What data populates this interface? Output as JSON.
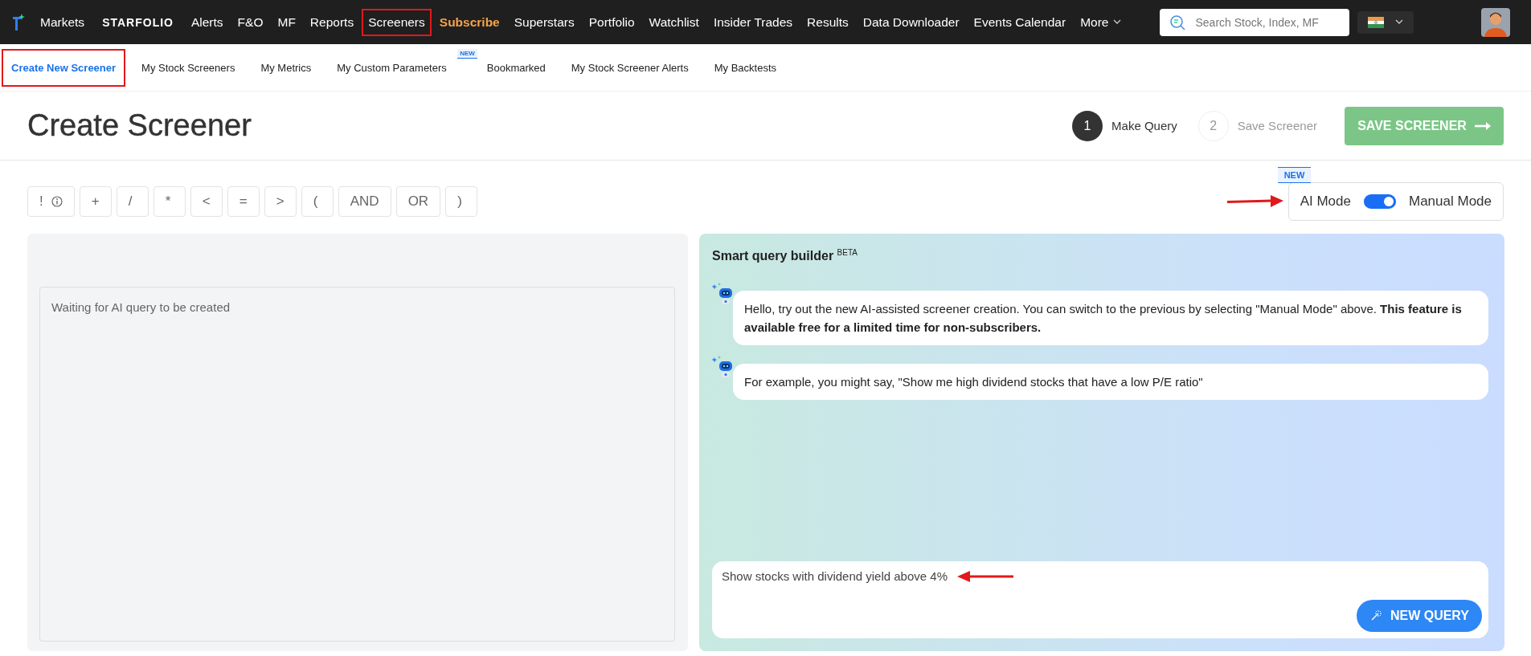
{
  "top_nav": {
    "items": [
      {
        "label": "Markets",
        "kind": "link",
        "highlighted": false
      },
      {
        "label": "STARFOLIO",
        "kind": "logo",
        "highlighted": false
      },
      {
        "label": "Alerts",
        "kind": "link",
        "highlighted": false
      },
      {
        "label": "F&O",
        "kind": "link",
        "highlighted": false
      },
      {
        "label": "MF",
        "kind": "link",
        "highlighted": false
      },
      {
        "label": "Reports",
        "kind": "link",
        "highlighted": false
      },
      {
        "label": "Screeners",
        "kind": "link",
        "highlighted": true
      },
      {
        "label": "Subscribe",
        "kind": "promo",
        "highlighted": false
      },
      {
        "label": "Superstars",
        "kind": "link",
        "highlighted": false
      },
      {
        "label": "Portfolio",
        "kind": "link",
        "highlighted": false
      },
      {
        "label": "Watchlist",
        "kind": "link",
        "highlighted": false
      },
      {
        "label": "Insider Trades",
        "kind": "link",
        "highlighted": false
      },
      {
        "label": "Results",
        "kind": "link",
        "highlighted": false
      },
      {
        "label": "Data Downloader",
        "kind": "link",
        "highlighted": false
      },
      {
        "label": "Events Calendar",
        "kind": "link",
        "highlighted": false
      },
      {
        "label": "More",
        "kind": "dropdown",
        "highlighted": false
      }
    ],
    "search": {
      "placeholder": "Search Stock, Index, MF"
    }
  },
  "sub_nav": {
    "tabs": [
      {
        "label": "Create New Screener",
        "selected": true,
        "highlighted": true
      },
      {
        "label": "My Stock Screeners",
        "selected": false,
        "highlighted": false
      },
      {
        "label": "My Metrics",
        "selected": false,
        "highlighted": false
      },
      {
        "label": "My Custom Parameters",
        "selected": false,
        "highlighted": false,
        "badge": "NEW"
      },
      {
        "label": "Bookmarked",
        "selected": false,
        "highlighted": false
      },
      {
        "label": "My Stock Screener Alerts",
        "selected": false,
        "highlighted": false
      },
      {
        "label": "My Backtests",
        "selected": false,
        "highlighted": false
      }
    ]
  },
  "header": {
    "title": "Create Screener",
    "steps": [
      {
        "number": "1",
        "label": "Make Query",
        "active": true
      },
      {
        "number": "2",
        "label": "Save Screener",
        "active": false
      }
    ],
    "save_button": {
      "label": "SAVE SCREENER",
      "disabled": true
    }
  },
  "operators": [
    {
      "label": "!",
      "kind": "info"
    },
    {
      "label": "+",
      "kind": "op"
    },
    {
      "label": "/",
      "kind": "op"
    },
    {
      "label": "*",
      "kind": "op"
    },
    {
      "label": "<",
      "kind": "op"
    },
    {
      "label": "=",
      "kind": "op"
    },
    {
      "label": ">",
      "kind": "op"
    },
    {
      "label": "(",
      "kind": "op"
    },
    {
      "label": "AND",
      "kind": "op"
    },
    {
      "label": "OR",
      "kind": "op"
    },
    {
      "label": ")",
      "kind": "op"
    }
  ],
  "mode_switch": {
    "badge": "NEW",
    "left_label": "AI Mode",
    "right_label": "Manual Mode",
    "ai_mode": true,
    "pointer_arrow": true
  },
  "query_editor": {
    "placeholder": "Waiting for AI query to be created"
  },
  "smart_query_builder": {
    "title": "Smart query builder",
    "title_badge": "BETA",
    "messages": [
      {
        "text": "Hello, try out the new AI-assisted screener creation. You can switch to the previous by selecting \"Manual Mode\" above. **This feature is available free for a limited time for non-subscribers.**"
      },
      {
        "text": "For example, you might say, \"Show me high dividend stocks that have a low P/E ratio\""
      }
    ],
    "input": {
      "value": "Show stocks with dividend yield above 4%",
      "pointer_arrow": true
    },
    "new_query_button": "NEW QUERY"
  }
}
